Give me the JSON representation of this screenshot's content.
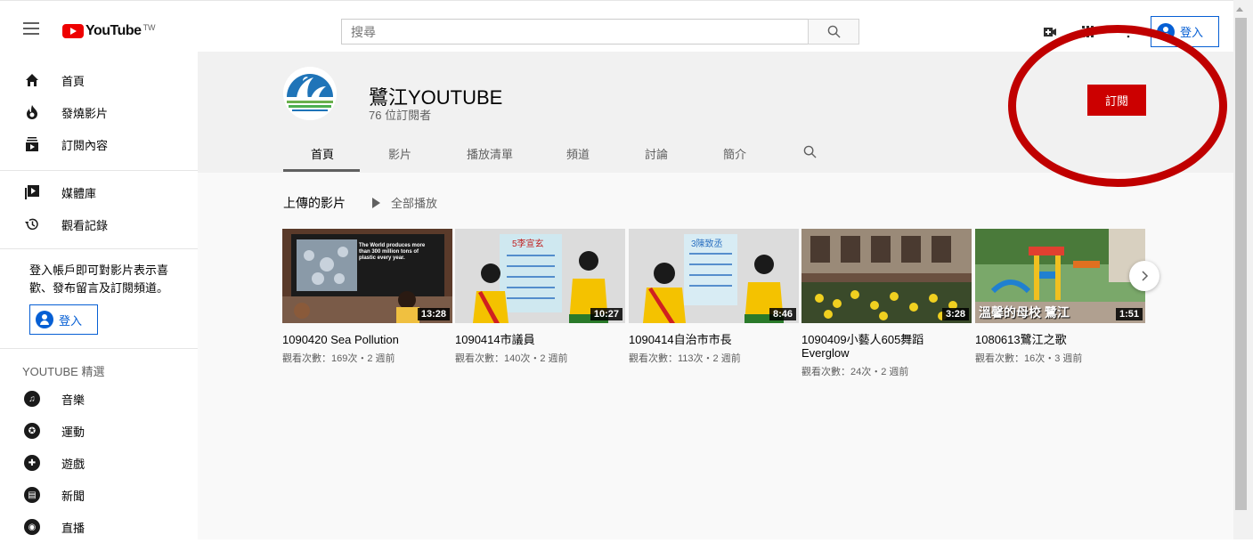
{
  "header": {
    "logo_text": "YouTube",
    "logo_region": "TW",
    "search_placeholder": "搜尋",
    "signin_label": "登入"
  },
  "sidebar": {
    "items": [
      {
        "label": "首頁",
        "icon": "home-icon"
      },
      {
        "label": "發燒影片",
        "icon": "trending-icon"
      },
      {
        "label": "訂閱內容",
        "icon": "subscriptions-icon"
      },
      {
        "label": "媒體庫",
        "icon": "library-icon"
      },
      {
        "label": "觀看記錄",
        "icon": "history-icon"
      }
    ],
    "note": "登入帳戶即可對影片表示喜歡、發布留言及訂閱頻道。",
    "signin_label": "登入",
    "section_title": "YOUTUBE 精選",
    "featured": [
      {
        "label": "音樂",
        "icon": "music-icon"
      },
      {
        "label": "運動",
        "icon": "sports-icon"
      },
      {
        "label": "遊戲",
        "icon": "gaming-icon"
      },
      {
        "label": "新聞",
        "icon": "news-icon"
      },
      {
        "label": "直播",
        "icon": "live-icon"
      }
    ]
  },
  "channel": {
    "name": "鷺江YOUTUBE",
    "subscribers": "76 位訂閱者",
    "subscribe_label": "訂閱",
    "tabs": [
      "首頁",
      "影片",
      "播放清單",
      "頻道",
      "討論",
      "簡介"
    ],
    "active_tab": "首頁"
  },
  "uploads": {
    "title": "上傳的影片",
    "play_all": "全部播放",
    "videos": [
      {
        "title": "1090420 Sea Pollution",
        "meta": "觀看次數：169次・2 週前",
        "duration": "13:28",
        "thumb_text": "The World produces more than 300 million tons of plastic every year."
      },
      {
        "title": "1090414市議員",
        "meta": "觀看次數：140次・2 週前",
        "duration": "10:27",
        "thumb_text": "5李宣玄"
      },
      {
        "title": "1090414自治市市長",
        "meta": "觀看次數：113次・2 週前",
        "duration": "8:46",
        "thumb_text": "3陳致丞"
      },
      {
        "title": "1090409小藝人605舞蹈 Everglow",
        "meta": "觀看次數：24次・2 週前",
        "duration": "3:28",
        "thumb_text": ""
      },
      {
        "title": "1080613鷺江之歌",
        "meta": "觀看次數：16次・3 週前",
        "duration": "1:51",
        "thumb_text": "溫馨的母校 鷺江"
      }
    ]
  },
  "colors": {
    "subscribe": "#cc0000",
    "link_blue": "#065fd4",
    "annotation_oval": "#c00000"
  }
}
